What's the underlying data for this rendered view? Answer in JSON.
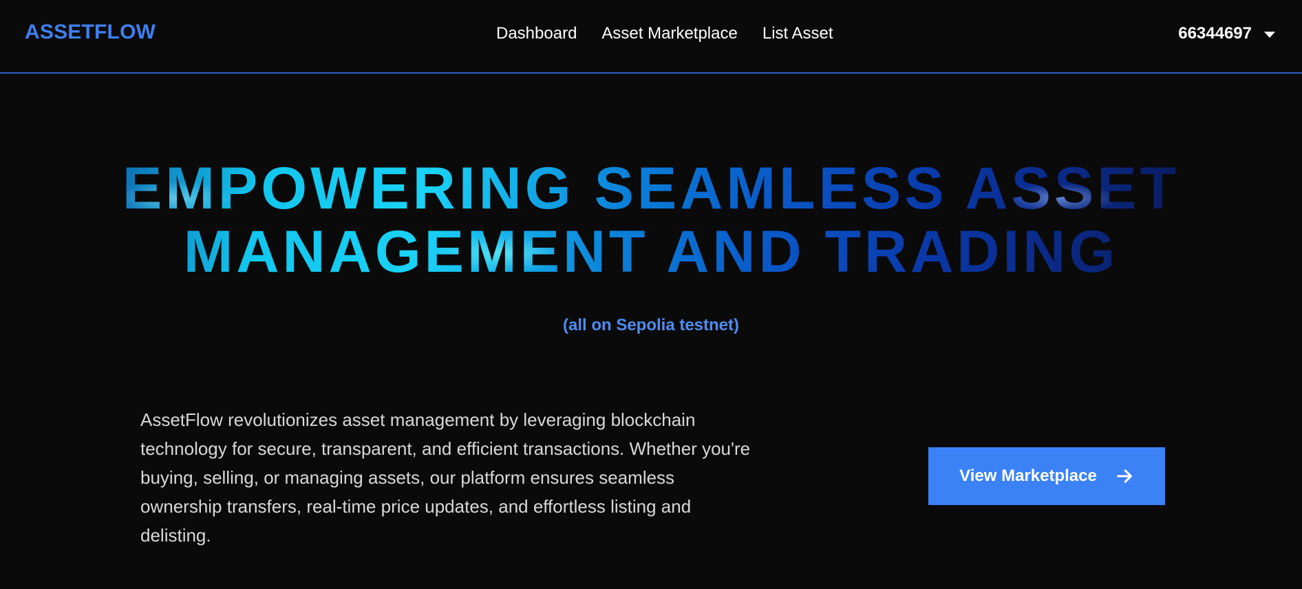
{
  "header": {
    "logo": "ASSETFLOW",
    "nav": [
      {
        "label": "Dashboard"
      },
      {
        "label": "Asset Marketplace"
      },
      {
        "label": "List Asset"
      }
    ],
    "account": {
      "id": "66344697",
      "icon": "chevron-down-icon"
    }
  },
  "hero": {
    "title_line1": "EMPOWERING SEAMLESS ASSET",
    "title_line2": "MANAGEMENT AND TRADING",
    "subtitle": "(all on Sepolia testnet)",
    "description": "AssetFlow revolutionizes asset management by leveraging blockchain technology for secure, transparent, and efficient transactions. Whether you're buying, selling, or managing assets, our platform ensures seamless ownership transfers, real-time price updates, and effortless listing and delisting.",
    "cta": {
      "label": "View Marketplace",
      "icon": "arrow-right-icon"
    }
  },
  "colors": {
    "background": "#0a0a0a",
    "accent": "#3b82f6",
    "logo": "#3e80f0",
    "divider": "#2f5fc8",
    "subtitle": "#4f8cf2"
  }
}
